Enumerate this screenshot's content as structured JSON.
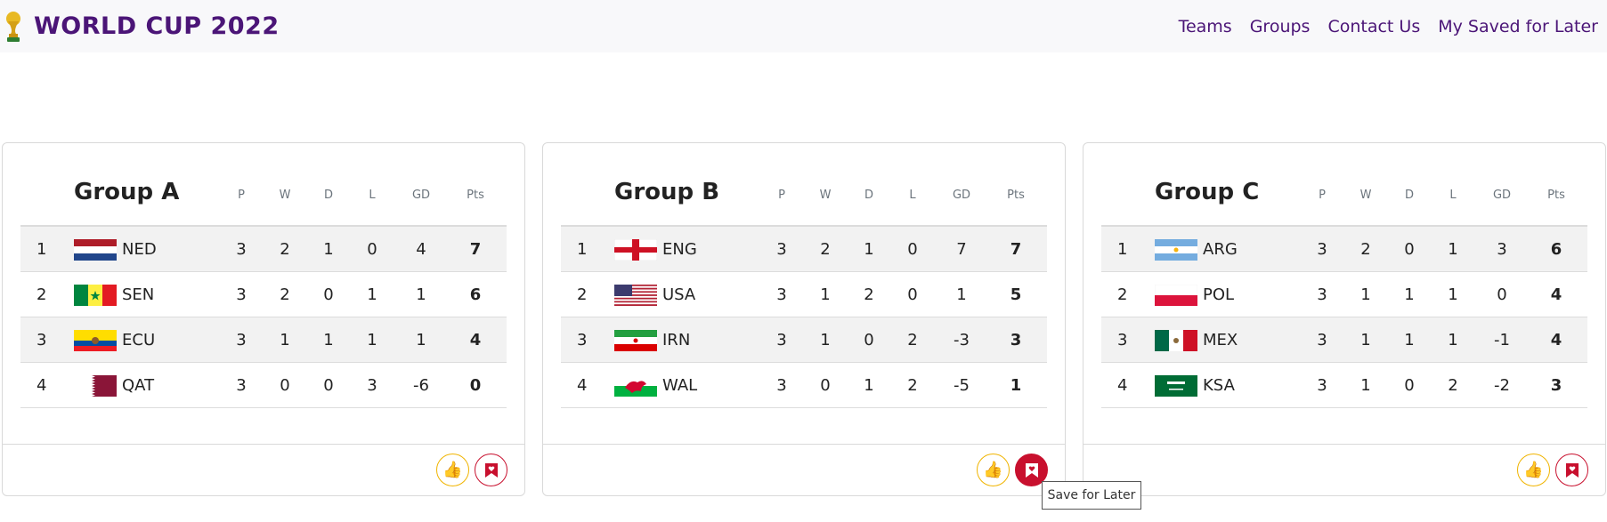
{
  "brand": {
    "title": "WORLD CUP 2022",
    "icon": "trophy-icon"
  },
  "nav": {
    "items": [
      "Teams",
      "Groups",
      "Contact Us",
      "My Saved for Later"
    ]
  },
  "headers": [
    "P",
    "W",
    "D",
    "L",
    "GD",
    "Pts"
  ],
  "tooltip": "Save for Later",
  "colors": {
    "brand": "#4b1577",
    "like": "#f0b400",
    "save": "#c8102e"
  },
  "groups": [
    {
      "title": "Group A",
      "rows": [
        {
          "pos": "1",
          "flag": "netherlands-flag",
          "code": "NED",
          "p": "3",
          "w": "2",
          "d": "1",
          "l": "0",
          "gd": "4",
          "pts": "7"
        },
        {
          "pos": "2",
          "flag": "senegal-flag",
          "code": "SEN",
          "p": "3",
          "w": "2",
          "d": "0",
          "l": "1",
          "gd": "1",
          "pts": "6"
        },
        {
          "pos": "3",
          "flag": "ecuador-flag",
          "code": "ECU",
          "p": "3",
          "w": "1",
          "d": "1",
          "l": "1",
          "gd": "1",
          "pts": "4"
        },
        {
          "pos": "4",
          "flag": "qatar-flag",
          "code": "QAT",
          "p": "3",
          "w": "0",
          "d": "0",
          "l": "3",
          "gd": "-6",
          "pts": "0"
        }
      ]
    },
    {
      "title": "Group B",
      "rows": [
        {
          "pos": "1",
          "flag": "england-flag",
          "code": "ENG",
          "p": "3",
          "w": "2",
          "d": "1",
          "l": "0",
          "gd": "7",
          "pts": "7"
        },
        {
          "pos": "2",
          "flag": "usa-flag",
          "code": "USA",
          "p": "3",
          "w": "1",
          "d": "2",
          "l": "0",
          "gd": "1",
          "pts": "5"
        },
        {
          "pos": "3",
          "flag": "iran-flag",
          "code": "IRN",
          "p": "3",
          "w": "1",
          "d": "0",
          "l": "2",
          "gd": "-3",
          "pts": "3"
        },
        {
          "pos": "4",
          "flag": "wales-flag",
          "code": "WAL",
          "p": "3",
          "w": "0",
          "d": "1",
          "l": "2",
          "gd": "-5",
          "pts": "1"
        }
      ]
    },
    {
      "title": "Group C",
      "rows": [
        {
          "pos": "1",
          "flag": "argentina-flag",
          "code": "ARG",
          "p": "3",
          "w": "2",
          "d": "0",
          "l": "1",
          "gd": "3",
          "pts": "6"
        },
        {
          "pos": "2",
          "flag": "poland-flag",
          "code": "POL",
          "p": "3",
          "w": "1",
          "d": "1",
          "l": "1",
          "gd": "0",
          "pts": "4"
        },
        {
          "pos": "3",
          "flag": "mexico-flag",
          "code": "MEX",
          "p": "3",
          "w": "1",
          "d": "1",
          "l": "1",
          "gd": "-1",
          "pts": "4"
        },
        {
          "pos": "4",
          "flag": "saudi-arabia-flag",
          "code": "KSA",
          "p": "3",
          "w": "1",
          "d": "0",
          "l": "2",
          "gd": "-2",
          "pts": "3"
        }
      ]
    }
  ]
}
